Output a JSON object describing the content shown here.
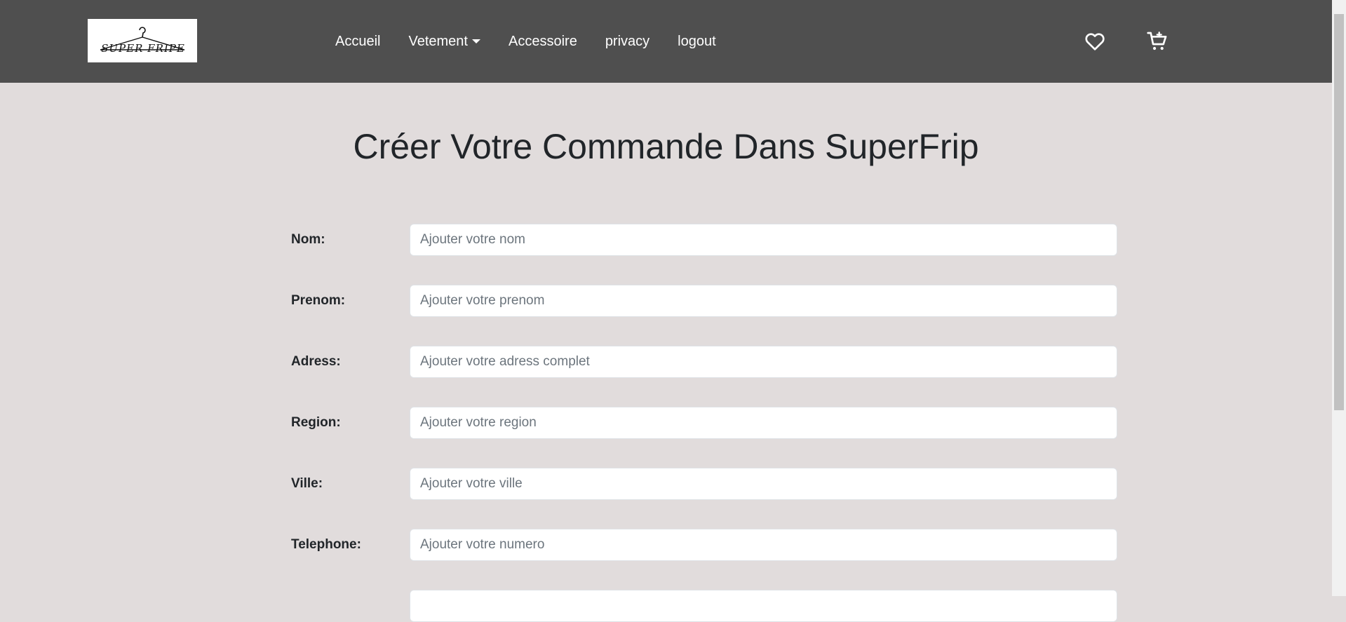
{
  "header": {
    "logo_text": "SUPER FRIPE",
    "nav": [
      {
        "label": "Accueil"
      },
      {
        "label": "Vetement"
      },
      {
        "label": "Accessoire"
      },
      {
        "label": "privacy"
      },
      {
        "label": "logout"
      }
    ],
    "icons": [
      "heart-icon",
      "cart-icon"
    ]
  },
  "main": {
    "title": "Créer Votre Commande Dans SuperFrip",
    "fields": [
      {
        "label": "Nom:",
        "placeholder": "Ajouter votre nom"
      },
      {
        "label": "Prenom:",
        "placeholder": "Ajouter votre prenom"
      },
      {
        "label": "Adress:",
        "placeholder": "Ajouter votre adress complet"
      },
      {
        "label": "Region:",
        "placeholder": "Ajouter votre region"
      },
      {
        "label": "Ville:",
        "placeholder": "Ajouter votre ville"
      },
      {
        "label": "Telephone:",
        "placeholder": "Ajouter votre numero"
      }
    ]
  },
  "colors": {
    "navbar": "#4f4f4f",
    "page_background": "#e1dcdc",
    "input_background": "#ffffff"
  }
}
